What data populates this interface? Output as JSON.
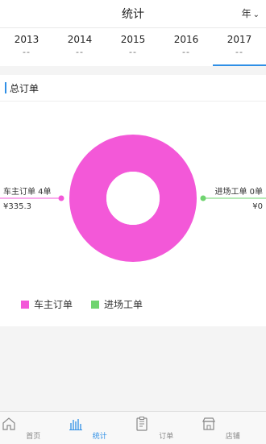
{
  "header": {
    "title": "统计",
    "period": "年"
  },
  "years": [
    {
      "label": "2013",
      "value": "--"
    },
    {
      "label": "2014",
      "value": "--"
    },
    {
      "label": "2015",
      "value": "--"
    },
    {
      "label": "2016",
      "value": "--"
    },
    {
      "label": "2017",
      "value": "--"
    }
  ],
  "section": {
    "title": "总订单"
  },
  "chart_data": {
    "type": "pie",
    "title": "",
    "series": [
      {
        "name": "车主订单",
        "label": "车主订单 4单",
        "amount": "¥335.3",
        "value": 4,
        "color": "#f358d8"
      },
      {
        "name": "进场工单",
        "label": "进场工单 0单",
        "amount": "¥0",
        "value": 0,
        "color": "#6fd46f"
      }
    ],
    "legend": "bottom"
  },
  "tabs": [
    {
      "label": "首页",
      "icon": "home-icon"
    },
    {
      "label": "统计",
      "icon": "stats-icon"
    },
    {
      "label": "订单",
      "icon": "order-icon"
    },
    {
      "label": "店铺",
      "icon": "shop-icon"
    }
  ],
  "colors": {
    "accent": "#2f8fe6"
  }
}
